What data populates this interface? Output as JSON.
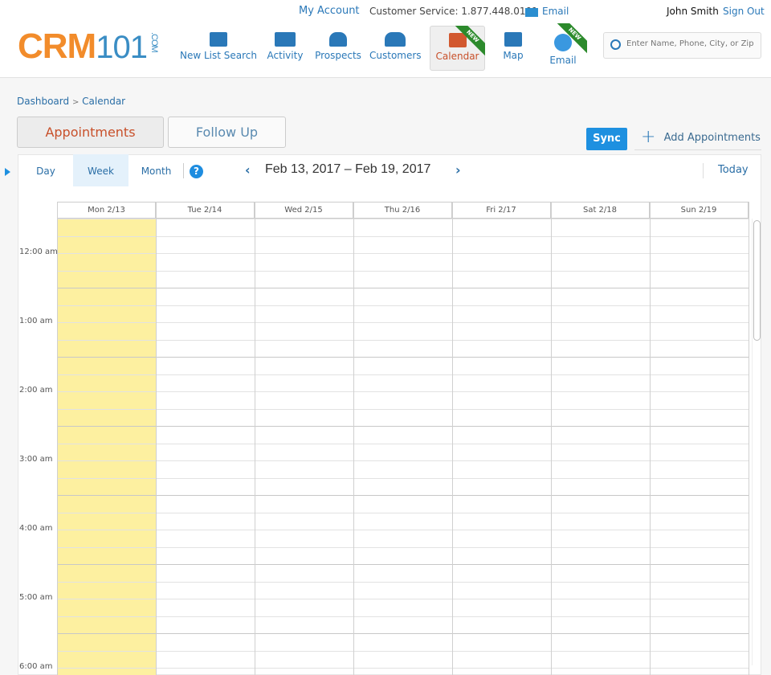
{
  "header": {
    "my_account": "My Account",
    "customer_service": "Customer Service: 1.877.448.0101",
    "email_link": "Email",
    "user": "John Smith",
    "sign_out": "Sign Out",
    "logo": {
      "brand": "CRM",
      "num": "101",
      "suffix": ".COM"
    },
    "nav": [
      {
        "label": "New List Search",
        "icon": "list-search-icon"
      },
      {
        "label": "Activity",
        "icon": "activity-icon"
      },
      {
        "label": "Prospects",
        "icon": "prospects-icon"
      },
      {
        "label": "Customers",
        "icon": "customers-icon"
      },
      {
        "label": "Calendar",
        "icon": "calendar-icon",
        "active": true,
        "badge": "NEW"
      },
      {
        "label": "Map",
        "icon": "map-icon"
      },
      {
        "label": "Email",
        "icon": "email-icon",
        "badge": "NEW"
      }
    ],
    "search_placeholder": "Enter Name, Phone, City, or Zip"
  },
  "breadcrumb": {
    "home": "Dashboard",
    "sep": ">",
    "current": "Calendar"
  },
  "tabs": {
    "appointments": "Appointments",
    "follow_up": "Follow Up"
  },
  "actions": {
    "sync": "Sync",
    "add": "Add Appointments"
  },
  "calendar": {
    "views": [
      "Day",
      "Week",
      "Month"
    ],
    "active_view": "Week",
    "help": "?",
    "range": "Feb 13, 2017 – Feb 19, 2017",
    "today": "Today",
    "days": [
      "Mon 2/13",
      "Tue 2/14",
      "Wed 2/15",
      "Thu 2/16",
      "Fri 2/17",
      "Sat 2/18",
      "Sun 2/19"
    ],
    "hours": [
      "12:00 am",
      "1:00 am",
      "2:00 am",
      "3:00 am",
      "4:00 am",
      "5:00 am",
      "6:00 am"
    ],
    "highlight_color": "#fdf0a0",
    "accent": "#1e90e0"
  }
}
